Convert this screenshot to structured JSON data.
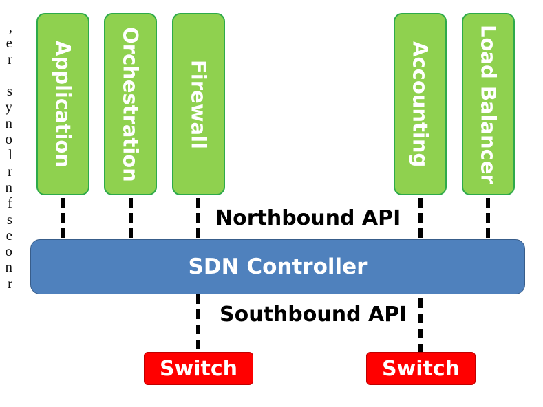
{
  "margin_text_fragments": [
    ",",
    "e",
    "r",
    "",
    "s",
    "y",
    "n",
    "o",
    "l",
    "r",
    "n",
    "f",
    "s",
    "e",
    "o",
    "n",
    "r"
  ],
  "applications": [
    {
      "label": "Application"
    },
    {
      "label": "Orchestration"
    },
    {
      "label": "Firewall"
    },
    {
      "label": "Accounting"
    },
    {
      "label": "Load Balancer"
    }
  ],
  "northbound_api": "Northbound API",
  "controller": {
    "label": "SDN Controller"
  },
  "southbound_api": "Southbound API",
  "switches": [
    {
      "label": "Switch"
    },
    {
      "label": "Switch"
    }
  ],
  "colors": {
    "application_fill": "#8fd14f",
    "application_border": "#2eaa4a",
    "controller_fill": "#4f81bd",
    "switch_fill": "#ff0000",
    "connector": "#000000"
  }
}
